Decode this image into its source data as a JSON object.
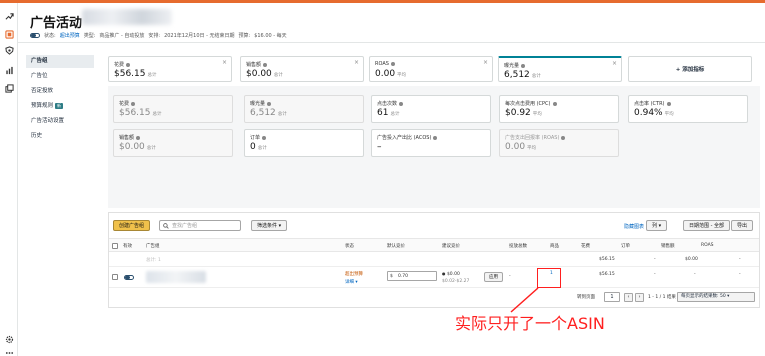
{
  "header": {
    "title": "广告活动",
    "meta": {
      "status_label": "状态:",
      "status_value": "超出预算",
      "type_label": "类型:",
      "type_value": "商品推广 - 自动投放",
      "schedule_label": "安排:",
      "schedule_value": "2021年12月10日 - 无结束日期",
      "budget_label": "预算:",
      "budget_value": "$16.00 - 每天"
    }
  },
  "sidebar": {
    "items": [
      {
        "label": "广告组",
        "active": true
      },
      {
        "label": "广告位"
      },
      {
        "label": "否定投放"
      },
      {
        "label": "预算规则",
        "badge": "新"
      },
      {
        "label": "广告活动设置"
      },
      {
        "label": "历史"
      }
    ]
  },
  "metric_cards_top": [
    {
      "label": "花费",
      "value": "$56.15",
      "unit": "总计"
    },
    {
      "label": "销售额",
      "value": "$0.00",
      "unit": "总计"
    },
    {
      "label": "ROAS",
      "value": "0.00",
      "unit": "平均"
    },
    {
      "label": "曝光量",
      "value": "6,512",
      "unit": "总计"
    },
    {
      "label": "+ 添加指标"
    }
  ],
  "metric_cards_row1": [
    {
      "label": "花费",
      "value": "$56.15",
      "unit": "总计"
    },
    {
      "label": "曝光量",
      "value": "6,512",
      "unit": "总计"
    },
    {
      "label": "点击次数",
      "value": "61",
      "unit": "总计"
    },
    {
      "label": "每次点击费用 (CPC)",
      "value": "$0.92",
      "unit": "平均"
    },
    {
      "label": "点击率 (CTR)",
      "value": "0.94%",
      "unit": "平均"
    }
  ],
  "metric_cards_row2": [
    {
      "label": "销售额",
      "value": "$0.00",
      "unit": "总计"
    },
    {
      "label": "订单",
      "value": "0",
      "unit": "总计"
    },
    {
      "label": "广告投入产出比 (ACOS)",
      "value": "–",
      "unit": ""
    },
    {
      "label": "广告支出回报率 (ROAS)",
      "value": "0.00",
      "unit": "平均"
    }
  ],
  "toolbar": {
    "create_label": "创建广告组",
    "search_placeholder": "查找广告组",
    "filter_label": "筛选条件",
    "hide_chart_label": "隐藏图表",
    "columns_label": "列",
    "date_range_label": "日期范围 - 全部",
    "export_label": "导出"
  },
  "table": {
    "headers": [
      "有效",
      "广告组",
      "状态",
      "默认竞价",
      "建议竞价",
      "投放总数",
      "商品",
      "花费",
      "订单",
      "销售额",
      "ROAS"
    ],
    "summary_row": {
      "name_prefix": "总计: 1",
      "spend": "$56.15",
      "orders": "-",
      "sales": "$0.00",
      "roas": "-"
    },
    "rows": [
      {
        "status": "超出预算",
        "status_detail": "详细",
        "currency": "$",
        "bid": "0.70",
        "suggested_main": "$0.00",
        "suggested_range": "$0.02-$2.27",
        "apply_label": "应用",
        "targets": "-",
        "products": "1",
        "spend": "$56.15",
        "orders": "-",
        "sales": "-",
        "roas": "-"
      }
    ],
    "pager": {
      "goto_label": "转到页面",
      "page": "1",
      "range_label": "1 - 1 / 1 结果",
      "per_page_label": "每页显示的结果数:",
      "per_page_value": "50"
    }
  },
  "annotation": {
    "text": "实际只开了一个ASIN",
    "color": "#ff1f1f"
  },
  "colors": {
    "accent": "#e66b2e",
    "link": "#0066c0",
    "teal": "#008296",
    "primary_button": "#f0c14b"
  }
}
